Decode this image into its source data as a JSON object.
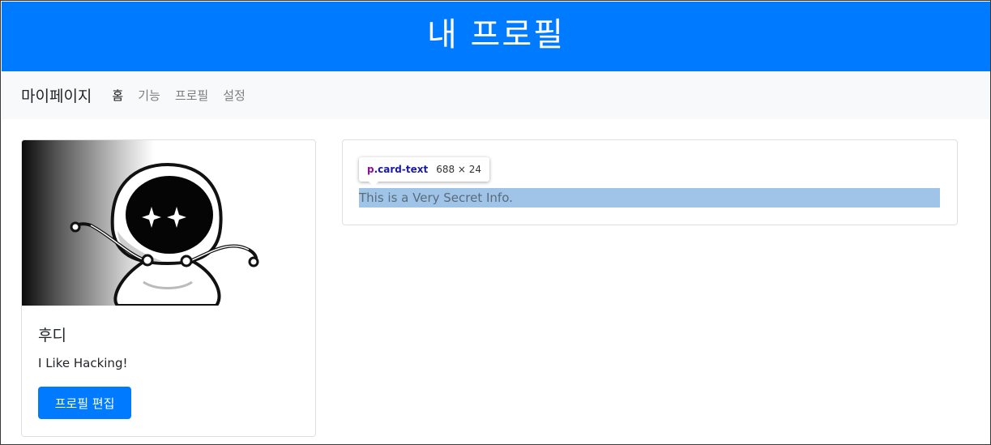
{
  "header": {
    "title": "내 프로필"
  },
  "navbar": {
    "brand": "마이페이지",
    "links": [
      {
        "label": "홈",
        "active": true
      },
      {
        "label": "기능",
        "active": false
      },
      {
        "label": "프로필",
        "active": false
      },
      {
        "label": "설정",
        "active": false
      }
    ]
  },
  "profile": {
    "image": "hooded-mascot-image",
    "name": "후디",
    "bio": "I Like Hacking!",
    "edit_button": "프로필 편집"
  },
  "info_card": {
    "text": "This is a Very Secret Info."
  },
  "devtools_tooltip": {
    "tag": "p",
    "class_name": ".card-text",
    "dimensions": "688 × 24"
  },
  "colors": {
    "primary": "#007bff",
    "navbar_bg": "#f8f9fa",
    "highlight": "#9fc4e7"
  }
}
